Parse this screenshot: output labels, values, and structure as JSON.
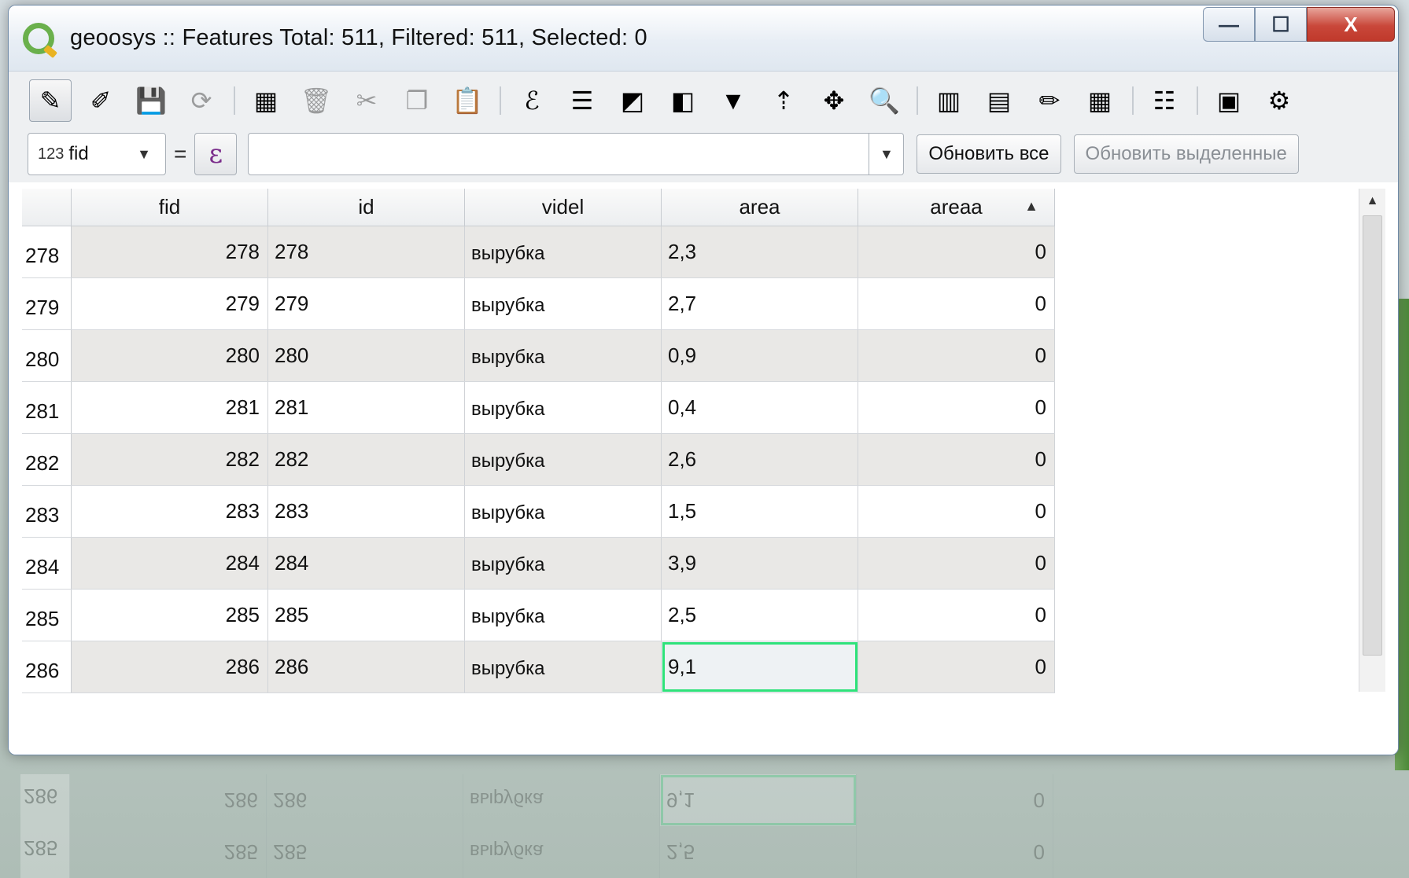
{
  "window": {
    "title": "geoosys :: Features Total: 511, Filtered: 511, Selected: 0",
    "controls": {
      "minimize": "—",
      "maximize": "☐",
      "close": "X"
    }
  },
  "toolbar": {
    "icons": [
      {
        "name": "toggle-editing-icon",
        "glyph": "✎",
        "active": true
      },
      {
        "name": "multi-edit-icon",
        "glyph": "✐"
      },
      {
        "name": "save-edits-icon",
        "glyph": "💾"
      },
      {
        "name": "reload-icon",
        "glyph": "⟳",
        "disabled": true
      },
      {
        "name": "add-feature-icon",
        "glyph": "▦"
      },
      {
        "name": "delete-icon",
        "glyph": "🗑",
        "disabled": true
      },
      {
        "name": "cut-icon",
        "glyph": "✂",
        "disabled": true
      },
      {
        "name": "copy-icon",
        "glyph": "❐",
        "disabled": true
      },
      {
        "name": "paste-icon",
        "glyph": "📋"
      },
      {
        "name": "expression-select-icon",
        "glyph": "ℰ"
      },
      {
        "name": "select-all-icon",
        "glyph": "☰"
      },
      {
        "name": "invert-selection-icon",
        "glyph": "◩"
      },
      {
        "name": "deselect-icon",
        "glyph": "◧"
      },
      {
        "name": "filter-icon",
        "glyph": "▼"
      },
      {
        "name": "move-to-top-icon",
        "glyph": "⇡"
      },
      {
        "name": "pan-to-icon",
        "glyph": "✥"
      },
      {
        "name": "zoom-to-icon",
        "glyph": "🔍"
      },
      {
        "name": "new-field-icon",
        "glyph": "▥"
      },
      {
        "name": "delete-field-icon",
        "glyph": "▤"
      },
      {
        "name": "field-calculator-icon",
        "glyph": "✏"
      },
      {
        "name": "conditional-format-icon",
        "glyph": "▦"
      },
      {
        "name": "dock-icon",
        "glyph": "☷"
      },
      {
        "name": "form-view-icon",
        "glyph": "▣"
      },
      {
        "name": "actions-icon",
        "glyph": "⚙"
      }
    ]
  },
  "filterbar": {
    "field_type": "123",
    "field_name": "fid",
    "equals": "=",
    "expr_symbol": "ε",
    "expr_value": "",
    "update_all": "Обновить все",
    "update_selected": "Обновить выделенные"
  },
  "table": {
    "headers": [
      "fid",
      "id",
      "videl",
      "area",
      "areaa"
    ],
    "rows": [
      {
        "num": "278",
        "fid": "278",
        "id": "278",
        "videl": "вырубка",
        "area": "2,3",
        "areaa": "0"
      },
      {
        "num": "279",
        "fid": "279",
        "id": "279",
        "videl": "вырубка",
        "area": "2,7",
        "areaa": "0"
      },
      {
        "num": "280",
        "fid": "280",
        "id": "280",
        "videl": "вырубка",
        "area": "0,9",
        "areaa": "0"
      },
      {
        "num": "281",
        "fid": "281",
        "id": "281",
        "videl": "вырубка",
        "area": "0,4",
        "areaa": "0"
      },
      {
        "num": "282",
        "fid": "282",
        "id": "282",
        "videl": "вырубка",
        "area": "2,6",
        "areaa": "0"
      },
      {
        "num": "283",
        "fid": "283",
        "id": "283",
        "videl": "вырубка",
        "area": "1,5",
        "areaa": "0"
      },
      {
        "num": "284",
        "fid": "284",
        "id": "284",
        "videl": "вырубка",
        "area": "3,9",
        "areaa": "0"
      },
      {
        "num": "285",
        "fid": "285",
        "id": "285",
        "videl": "вырубка",
        "area": "2,5",
        "areaa": "0"
      },
      {
        "num": "286",
        "fid": "286",
        "id": "286",
        "videl": "вырубка",
        "area": "9,1",
        "areaa": "0",
        "selected_col": "area"
      }
    ]
  },
  "colors": {
    "selected_outline": "#2ee27a",
    "alt_row": "#e9e8e6"
  }
}
